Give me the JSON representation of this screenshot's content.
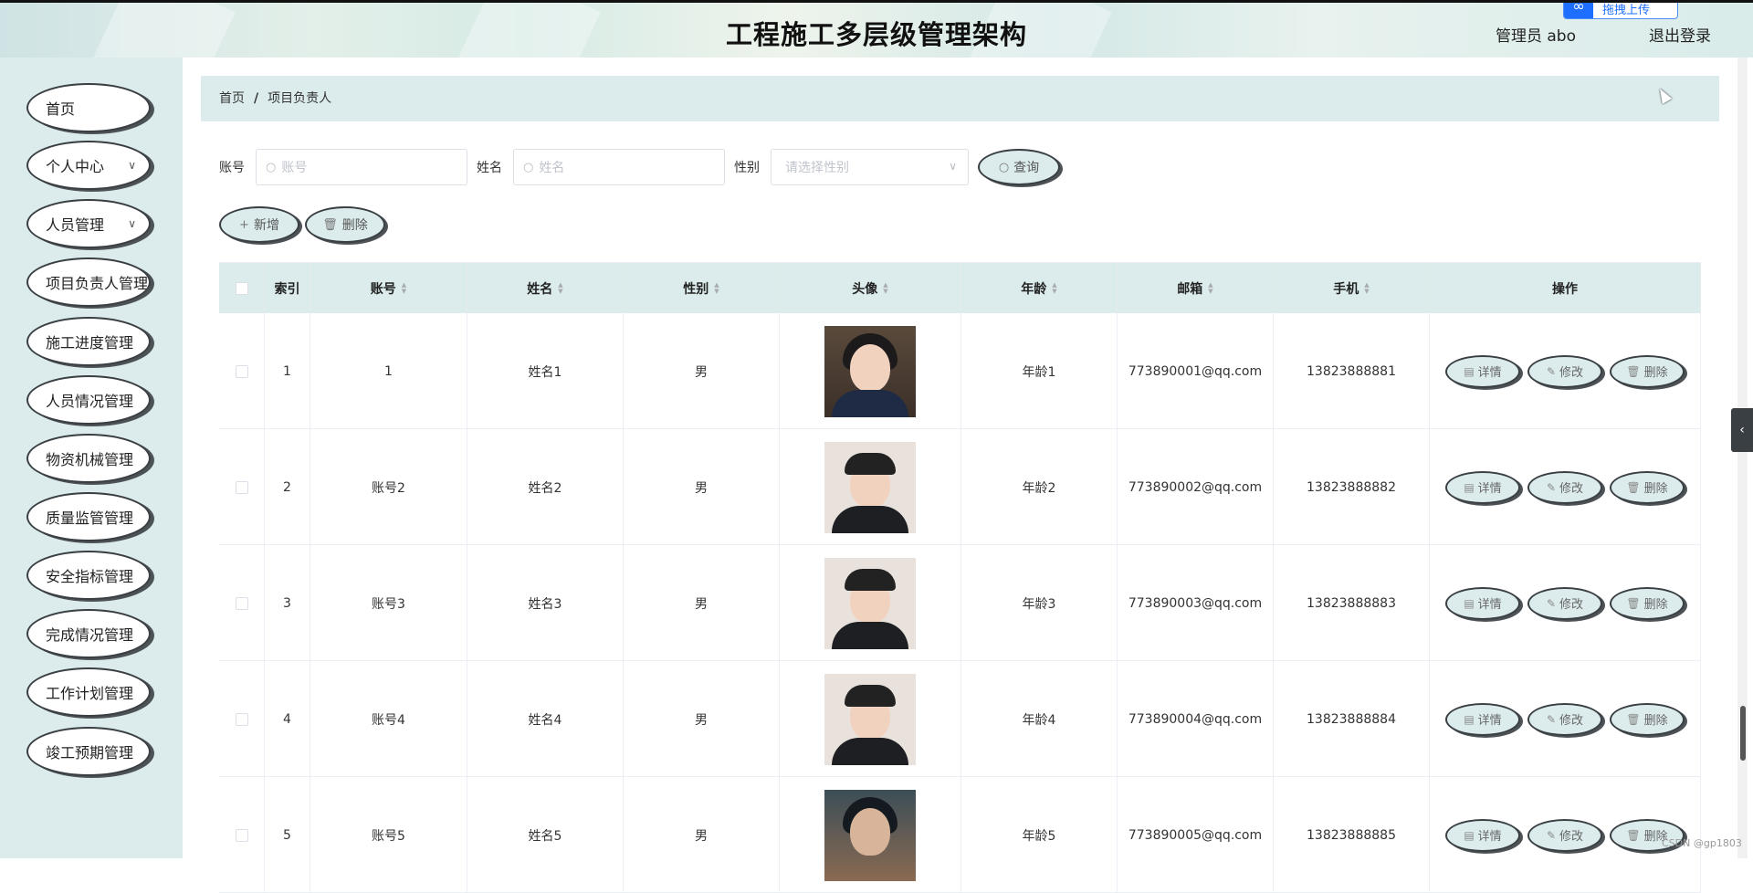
{
  "header": {
    "title": "工程施工多层级管理架构",
    "user_label": "管理员 abo",
    "logout_label": "退出登录",
    "upload_label": "拖拽上传"
  },
  "sidebar": {
    "items": [
      {
        "label": "首页",
        "has_children": false
      },
      {
        "label": "个人中心",
        "has_children": true
      },
      {
        "label": "人员管理",
        "has_children": true
      },
      {
        "label": "项目负责人管理",
        "has_children": false
      },
      {
        "label": "施工进度管理",
        "has_children": false
      },
      {
        "label": "人员情况管理",
        "has_children": false
      },
      {
        "label": "物资机械管理",
        "has_children": false
      },
      {
        "label": "质量监管管理",
        "has_children": false
      },
      {
        "label": "安全指标管理",
        "has_children": false
      },
      {
        "label": "完成情况管理",
        "has_children": false
      },
      {
        "label": "工作计划管理",
        "has_children": false
      },
      {
        "label": "竣工预期管理",
        "has_children": false
      }
    ]
  },
  "breadcrumb": {
    "home": "首页",
    "separator": "/",
    "current": "项目负责人"
  },
  "search": {
    "account_label": "账号",
    "account_placeholder": "账号",
    "name_label": "姓名",
    "name_placeholder": "姓名",
    "gender_label": "性别",
    "gender_placeholder": "请选择性别",
    "query_button": "查询"
  },
  "actions": {
    "add_button": "新增",
    "delete_button": "删除"
  },
  "table": {
    "columns": [
      "索引",
      "账号",
      "姓名",
      "性别",
      "头像",
      "年龄",
      "邮箱",
      "手机",
      "操作"
    ],
    "rows": [
      {
        "index": "1",
        "account": "1",
        "name": "姓名1",
        "gender": "男",
        "avatar": "girl",
        "age": "年龄1",
        "email": "773890001@qq.com",
        "phone": "13823888881"
      },
      {
        "index": "2",
        "account": "账号2",
        "name": "姓名2",
        "gender": "男",
        "avatar": "boy",
        "age": "年龄2",
        "email": "773890002@qq.com",
        "phone": "13823888882"
      },
      {
        "index": "3",
        "account": "账号3",
        "name": "姓名3",
        "gender": "男",
        "avatar": "boy",
        "age": "年龄3",
        "email": "773890003@qq.com",
        "phone": "13823888883"
      },
      {
        "index": "4",
        "account": "账号4",
        "name": "姓名4",
        "gender": "男",
        "avatar": "boy",
        "age": "年龄4",
        "email": "773890004@qq.com",
        "phone": "13823888884"
      },
      {
        "index": "5",
        "account": "账号5",
        "name": "姓名5",
        "gender": "男",
        "avatar": "dark",
        "age": "年龄5",
        "email": "773890005@qq.com",
        "phone": "13823888885"
      }
    ],
    "row_actions": {
      "detail": "详情",
      "edit": "修改",
      "delete": "删除"
    }
  },
  "watermark": "CSDN @gp1803",
  "colors": {
    "accent_bg": "#dceced",
    "pill_border": "#3a3f44"
  }
}
